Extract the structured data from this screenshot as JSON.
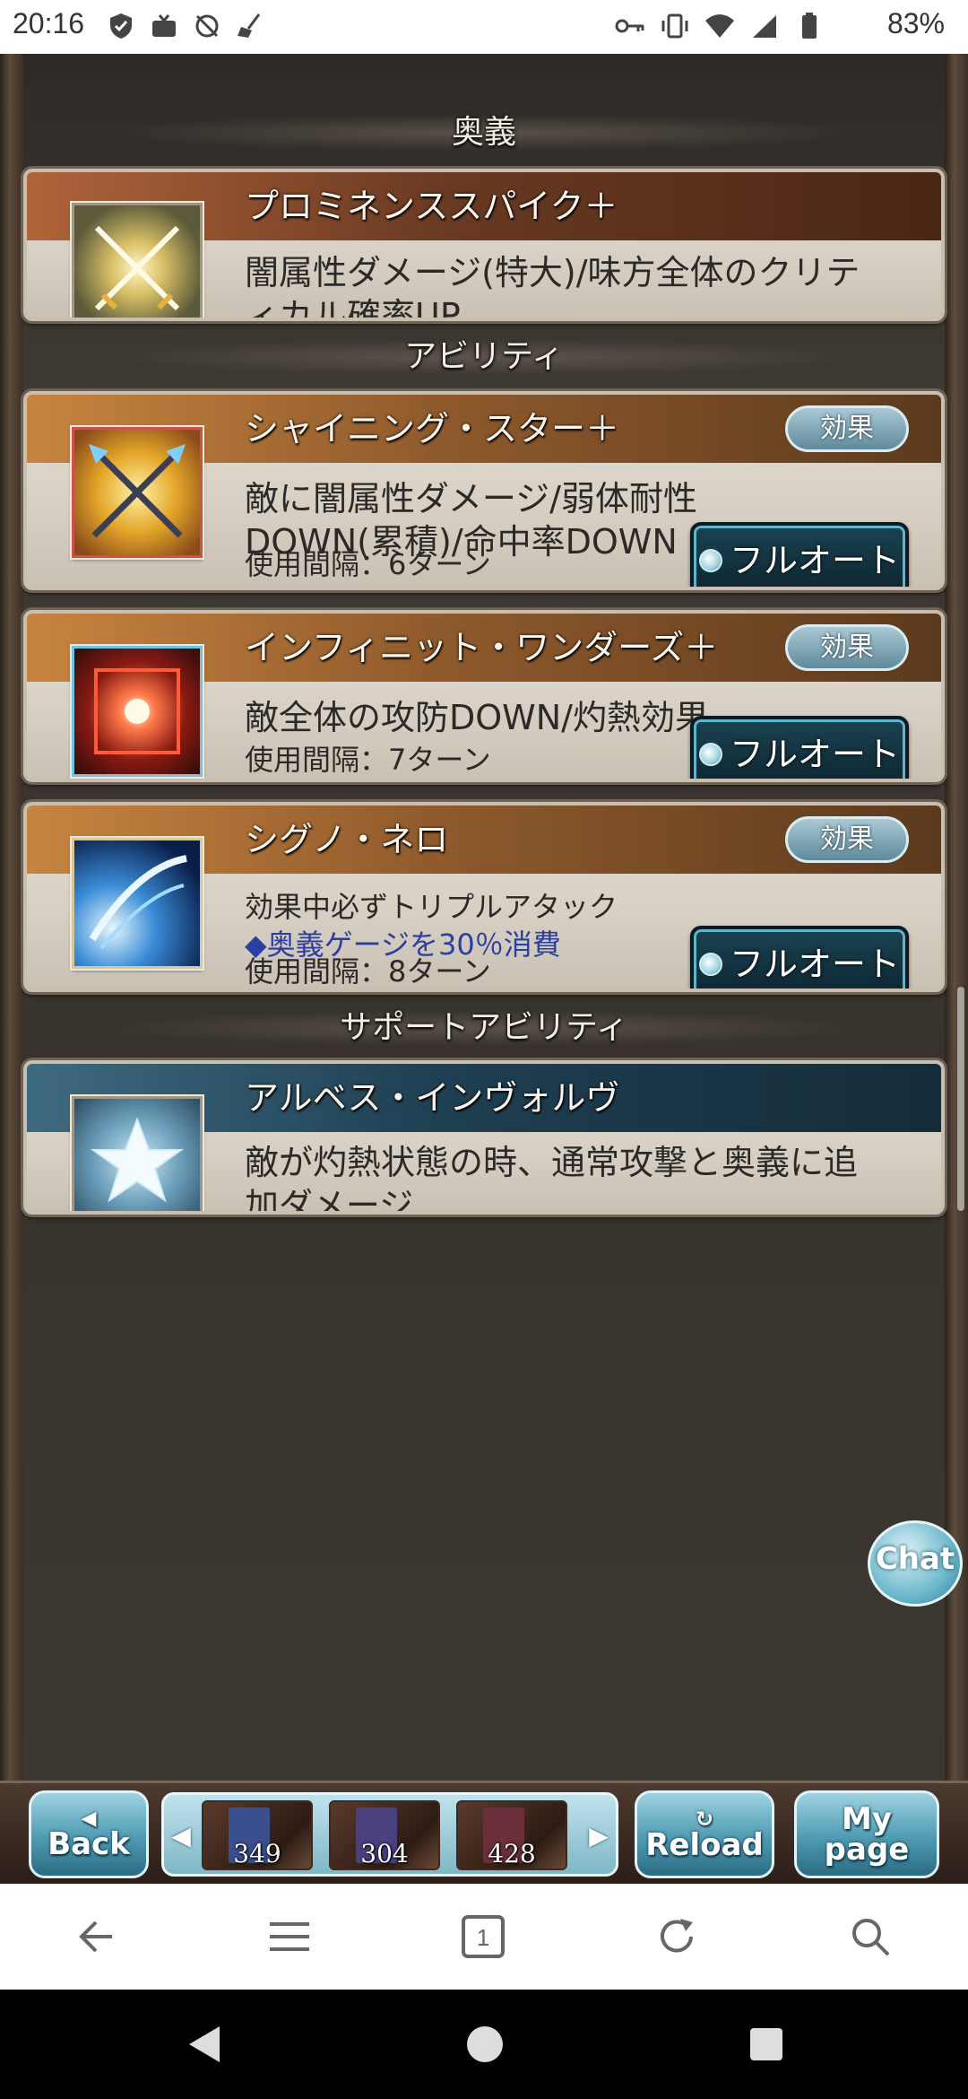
{
  "status_bar": {
    "time": "20:16",
    "battery_percent": "83%",
    "left_icons": [
      "shield-icon",
      "tv-icon",
      "no-sync-icon",
      "broom-icon"
    ],
    "right_icons": [
      "key-icon",
      "vibrate-icon",
      "wifi-icon",
      "signal-icon",
      "battery-icon"
    ]
  },
  "sections": {
    "ougi": "奥義",
    "ability": "アビリティ",
    "support": "サポートアビリティ"
  },
  "ougi_card": {
    "title": "プロミネンススパイク＋",
    "description": "闇属性ダメージ(特大)/味方全体のクリティカル確率UP",
    "description_line1": "闇属性ダメージ(特大)/味方全体のクリテ",
    "description_line2": "ィカル確率UP"
  },
  "abilities": [
    {
      "title": "シャイニング・スター＋",
      "effect_label": "効果",
      "description_line1": "敵に闇属性ダメージ/弱体耐性",
      "description_line2": "DOWN(累積)/命中率DOWN",
      "interval": "使用間隔：6ターン",
      "fullauto_label": "フルオート"
    },
    {
      "title": "インフィニット・ワンダーズ＋",
      "effect_label": "効果",
      "description_line1": "敵全体の攻防DOWN/灼熱効果",
      "interval": "使用間隔：7ターン",
      "fullauto_label": "フルオート"
    },
    {
      "title": "シグノ・ネロ",
      "effect_label": "効果",
      "description_line1": "効果中必ずトリプルアタック",
      "note": "◆奥義ゲージを30％消費",
      "interval": "使用間隔：8ターン",
      "fullauto_label": "フルオート"
    }
  ],
  "support_card": {
    "title": "アルベス・インヴォルヴ",
    "description_line1": "敵が灼熱状態の時、通常攻撃と奥義に追",
    "description_line2": "加ダメージ"
  },
  "chat_button": "Chat",
  "game_nav": {
    "back_label": "Back",
    "reload_label": "Reload",
    "mypage_line1": "My",
    "mypage_line2": "page",
    "books": [
      {
        "count": "349",
        "color": "#3b4f8f"
      },
      {
        "count": "304",
        "color": "#4a3f7f"
      },
      {
        "count": "428",
        "color": "#6b2f3a"
      }
    ]
  },
  "browser_toolbar": {
    "tab_count": "1",
    "icons": [
      "back-arrow-icon",
      "menu-icon",
      "tabs-icon",
      "refresh-icon",
      "search-icon"
    ]
  }
}
